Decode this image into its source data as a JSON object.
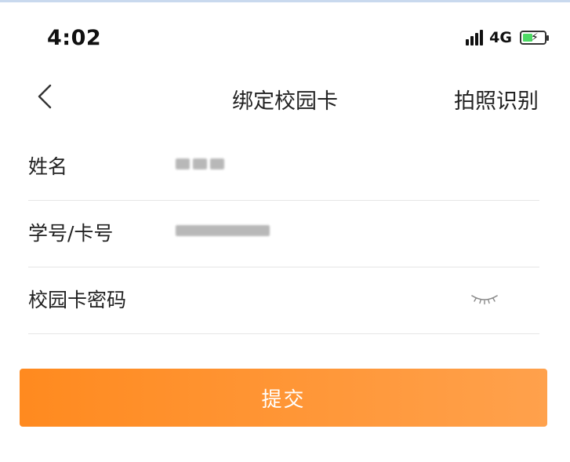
{
  "status_bar": {
    "time": "4:02",
    "network": "4G",
    "signal_icon": "signal-bars-icon",
    "battery_icon": "battery-charging-icon",
    "battery_color": "#4cd964"
  },
  "nav": {
    "back_icon": "chevron-left-icon",
    "title": "绑定校园卡",
    "action_label": "拍照识别"
  },
  "form": {
    "name_label": "姓名",
    "student_id_label": "学号/卡号",
    "password_label": "校园卡密码",
    "password_placeholder": "",
    "eye_icon": "eye-closed-icon"
  },
  "submit": {
    "label": "提交",
    "gradient_start": "#ff8a1f",
    "gradient_end": "#ffa14c"
  }
}
